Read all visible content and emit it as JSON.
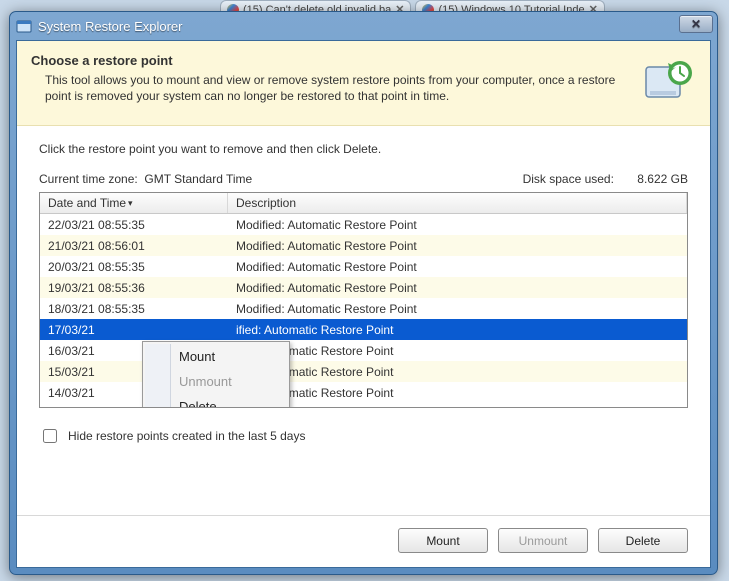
{
  "background_tabs": [
    {
      "label": "(15) Can't delete old invalid ba"
    },
    {
      "label": "(15) Windows 10 Tutorial Inde"
    }
  ],
  "window": {
    "title": "System Restore Explorer"
  },
  "banner": {
    "heading": "Choose a restore point",
    "desc": "This tool allows you to mount and view or remove system restore points from your computer, once a restore point is removed your system can no longer be restored to that point in time."
  },
  "instruction": "Click the restore point you want to remove and then click Delete.",
  "timezone_label": "Current time zone:",
  "timezone_value": "GMT Standard Time",
  "disk_label": "Disk space used:",
  "disk_value": "8.622 GB",
  "columns": {
    "date": "Date and Time",
    "desc": "Description"
  },
  "rows": [
    {
      "date": "22/03/21 08:55:35",
      "desc": "Modified: Automatic Restore Point",
      "selected": false
    },
    {
      "date": "21/03/21 08:56:01",
      "desc": "Modified: Automatic Restore Point",
      "selected": false
    },
    {
      "date": "20/03/21 08:55:35",
      "desc": "Modified: Automatic Restore Point",
      "selected": false
    },
    {
      "date": "19/03/21 08:55:36",
      "desc": "Modified: Automatic Restore Point",
      "selected": false
    },
    {
      "date": "18/03/21 08:55:35",
      "desc": "Modified: Automatic Restore Point",
      "selected": false
    },
    {
      "date": "17/03/21",
      "desc": "ified: Automatic Restore Point",
      "selected": true
    },
    {
      "date": "16/03/21",
      "desc": "ified: Automatic Restore Point",
      "selected": false
    },
    {
      "date": "15/03/21",
      "desc": "ified: Automatic Restore Point",
      "selected": false
    },
    {
      "date": "14/03/21",
      "desc": "ified: Automatic Restore Point",
      "selected": false
    }
  ],
  "context_menu": {
    "mount": "Mount",
    "unmount": "Unmount",
    "delete": "Delete"
  },
  "hide_checkbox_label": "Hide restore points created in the last 5 days",
  "buttons": {
    "mount": "Mount",
    "unmount": "Unmount",
    "delete": "Delete"
  }
}
